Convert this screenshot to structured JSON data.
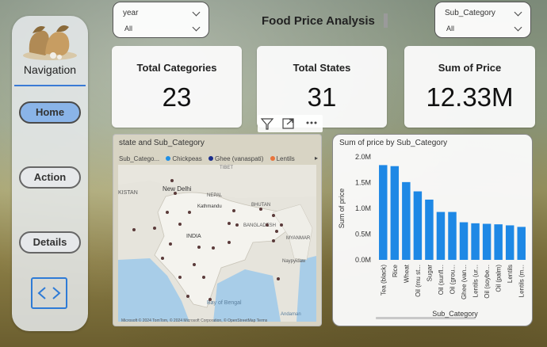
{
  "navigation": {
    "title": "Navigation",
    "buttons": [
      "Home",
      "Action",
      "Details"
    ],
    "active": "Home"
  },
  "slicers": {
    "year": {
      "label": "year",
      "value": "All"
    },
    "sub_category": {
      "label": "Sub_Category",
      "value": "All"
    }
  },
  "page_title": "Food Price Analysis",
  "kpis": [
    {
      "label": "Total Categories",
      "value": "23"
    },
    {
      "label": "Total States",
      "value": "31"
    },
    {
      "label": "Sum of Price",
      "value": "12.33M"
    }
  ],
  "map": {
    "title": "state and Sub_Category",
    "legend_label": "Sub_Catego...",
    "legend": [
      {
        "name": "Chickpeas",
        "color": "#1f8fe5"
      },
      {
        "name": "Ghee (vanaspati)",
        "color": "#1a2d8a"
      },
      {
        "name": "Lentils",
        "color": "#e8743b"
      }
    ],
    "labels": [
      "TIBET",
      "KISTAN",
      "New Delhi",
      "NEPAL",
      "Kathmandu",
      "BHUTAN",
      "BANGLADESH",
      "INDIA",
      "MYANMAR",
      "Naypyidaw",
      "Bay of Bengal",
      "Andaman"
    ],
    "attribution": "Microsoft  © 2024 TomTom, © 2024 Microsoft Corporation, © OpenStreetMap  Terms",
    "point_color": "#5a3a3a"
  },
  "chart_data": {
    "type": "bar",
    "title": "Sum of price by Sub_Category",
    "xlabel": "Sub_Category",
    "ylabel": "Sum of price",
    "categories": [
      "Tea (black)",
      "Rice",
      "Wheat",
      "Oil (mustard)",
      "Sugar",
      "Oil (sunflower)",
      "Oil (groundnut)",
      "Ghee (vanaspati)",
      "Lentils (urad)",
      "Oil (soybean)",
      "Oil (palm)",
      "Lentils",
      "Lentils (masur)"
    ],
    "tick_labels": [
      "Tea (black)",
      "Rice",
      "Wheat",
      "Oil (mu st...",
      "Sugar",
      "Oil (sunfl...",
      "Oil (grou...",
      "Ghee (van...",
      "Lentils (ur...",
      "Oil (soybe...",
      "Oil (palm)",
      "Lentils",
      "Lentils (m..."
    ],
    "values": [
      1.84,
      1.82,
      1.51,
      1.33,
      1.17,
      0.93,
      0.93,
      0.73,
      0.71,
      0.7,
      0.69,
      0.67,
      0.64
    ],
    "ylim": [
      0,
      2.0
    ],
    "yticks": [
      "0.0M",
      "0.5M",
      "1.0M",
      "1.5M",
      "2.0M"
    ],
    "bar_color": "#1e88e5",
    "grid": false
  }
}
